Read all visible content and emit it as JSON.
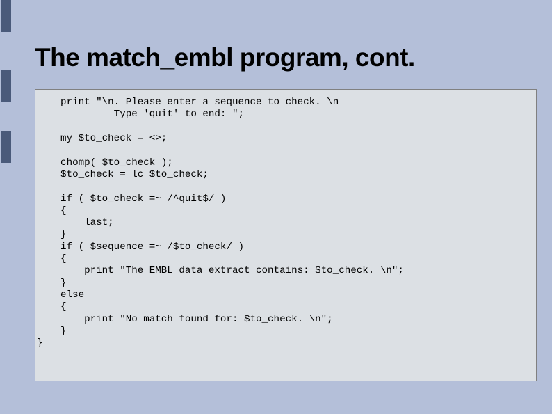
{
  "title": "The match_embl program, cont.",
  "code": {
    "l01": "    print \"\\n. Please enter a sequence to check. \\n",
    "l02": "             Type 'quit' to end: \";",
    "l03": "",
    "l04": "    my $to_check = <>;",
    "l05": "",
    "l06": "    chomp( $to_check );",
    "l07": "    $to_check = lc $to_check;",
    "l08": "",
    "l09": "    if ( $to_check =~ /^quit$/ )",
    "l10": "    {",
    "l11": "        last;",
    "l12": "    }",
    "l13": "    if ( $sequence =~ /$to_check/ )",
    "l14": "    {",
    "l15": "        print \"The EMBL data extract contains: $to_check. \\n\";",
    "l16": "    }",
    "l17": "    else",
    "l18": "    {",
    "l19": "        print \"No match found for: $to_check. \\n\";",
    "l20": "    }",
    "l21": "}"
  }
}
